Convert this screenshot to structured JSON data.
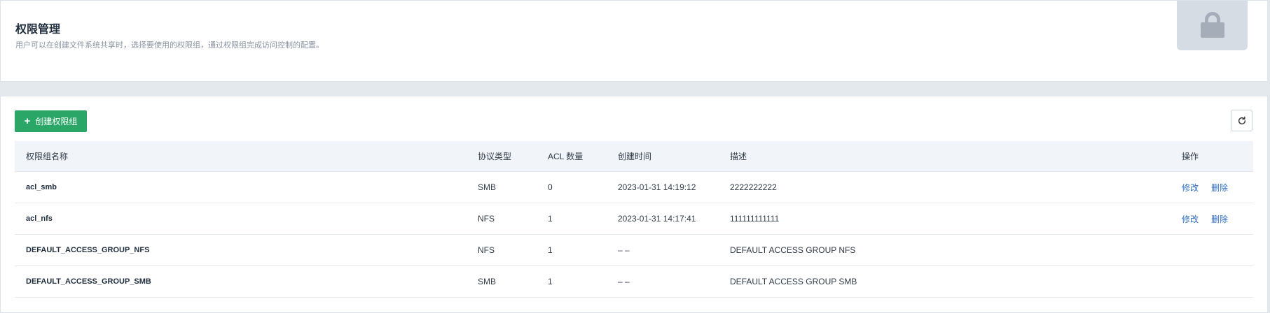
{
  "header": {
    "title": "权限管理",
    "description": "用户可以在创建文件系统共享时，选择要使用的权限组，通过权限组完成访问控制的配置。",
    "icon": "lock-icon"
  },
  "toolbar": {
    "create_label": "创建权限组",
    "create_icon": "plus-icon",
    "refresh_icon": "refresh-icon"
  },
  "table": {
    "columns": {
      "name": "权限组名称",
      "protocol": "协议类型",
      "acl_count": "ACL 数量",
      "created": "创建时间",
      "description": "描述",
      "actions": "操作"
    },
    "rows": [
      {
        "name": "acl_smb",
        "protocol": "SMB",
        "acl_count": "0",
        "created": "2023-01-31 14:19:12",
        "description": "2222222222",
        "edit": "修改",
        "delete": "删除"
      },
      {
        "name": "acl_nfs",
        "protocol": "NFS",
        "acl_count": "1",
        "created": "2023-01-31 14:17:41",
        "description": "111111111111",
        "edit": "修改",
        "delete": "删除"
      },
      {
        "name": "DEFAULT_ACCESS_GROUP_NFS",
        "protocol": "NFS",
        "acl_count": "1",
        "created": "– –",
        "description": "DEFAULT ACCESS GROUP NFS"
      },
      {
        "name": "DEFAULT_ACCESS_GROUP_SMB",
        "protocol": "SMB",
        "acl_count": "1",
        "created": "– –",
        "description": "DEFAULT ACCESS GROUP SMB"
      }
    ]
  },
  "colors": {
    "accent": "#2aa767",
    "link": "#2d6fc2",
    "page_bg": "#e4e9ee"
  }
}
